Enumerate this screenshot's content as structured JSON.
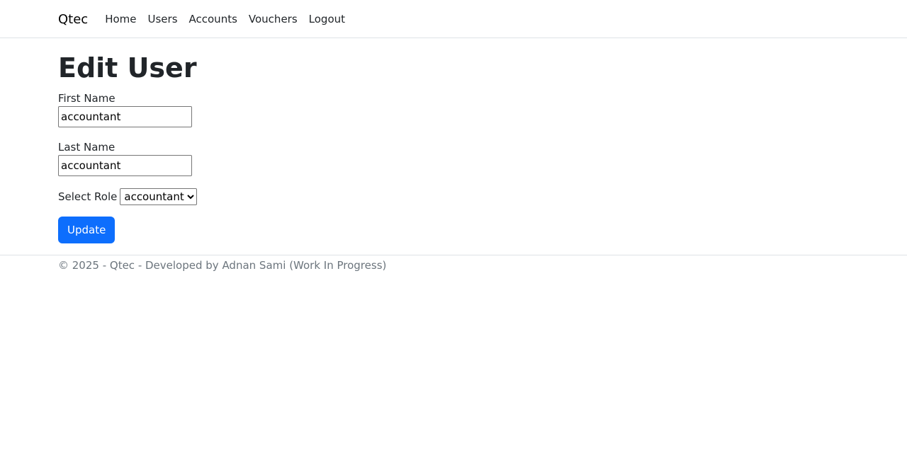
{
  "navbar": {
    "brand": "Qtec",
    "links": [
      {
        "label": "Home"
      },
      {
        "label": "Users"
      },
      {
        "label": "Accounts"
      },
      {
        "label": "Vouchers"
      },
      {
        "label": "Logout"
      }
    ]
  },
  "main": {
    "title": "Edit User",
    "first_name": {
      "label": "First Name",
      "value": "accountant"
    },
    "last_name": {
      "label": "Last Name",
      "value": "accountant"
    },
    "role": {
      "label": "Select Role",
      "selected": "accountant"
    },
    "update_label": "Update"
  },
  "footer": {
    "text": "© 2025 - Qtec - Developed by Adnan Sami (Work In Progress)"
  },
  "colors": {
    "primary": "#0d6efd",
    "muted_text": "#6c757d",
    "border": "#dee2e6"
  }
}
